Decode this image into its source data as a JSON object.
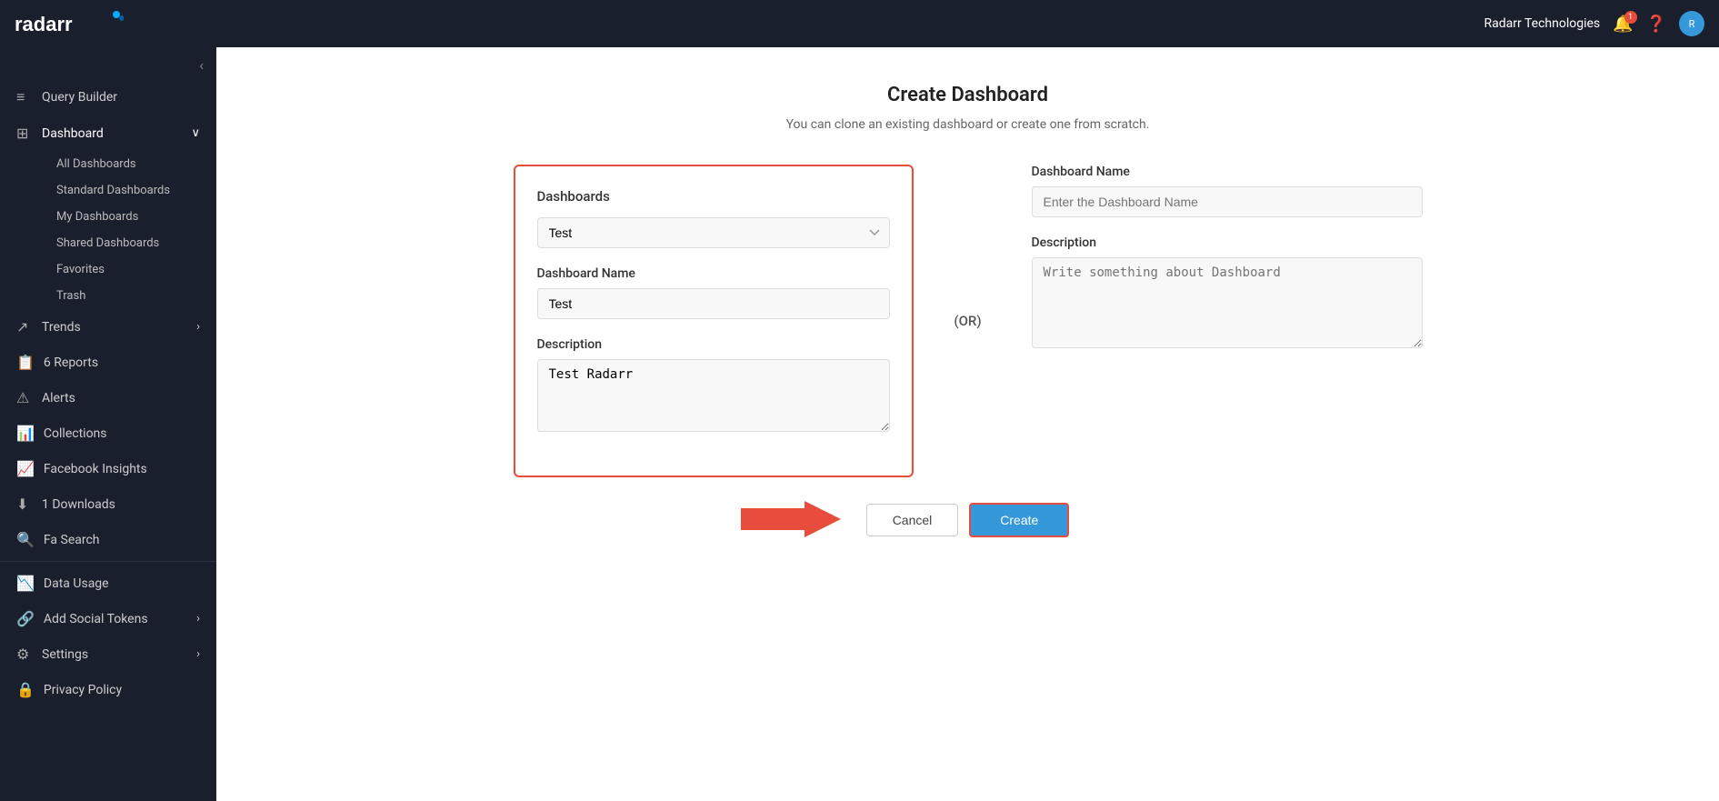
{
  "navbar": {
    "logo": "radarr",
    "company": "Radarr Technologies",
    "notification_count": "1",
    "avatar_text": "R"
  },
  "sidebar": {
    "collapse_icon": "‹",
    "items": [
      {
        "id": "query-builder",
        "label": "Query Builder",
        "icon": "≡",
        "has_chevron": false
      },
      {
        "id": "dashboard",
        "label": "Dashboard",
        "icon": "⊞",
        "has_chevron": true,
        "expanded": true
      },
      {
        "id": "all-dashboards",
        "label": "All Dashboards",
        "sub": true
      },
      {
        "id": "standard-dashboards",
        "label": "Standard Dashboards",
        "sub": true
      },
      {
        "id": "my-dashboards",
        "label": "My Dashboards",
        "sub": true
      },
      {
        "id": "shared-dashboards",
        "label": "Shared Dashboards",
        "sub": true
      },
      {
        "id": "favorites",
        "label": "Favorites",
        "sub": true
      },
      {
        "id": "trash",
        "label": "Trash",
        "sub": true
      },
      {
        "id": "trends",
        "label": "Trends",
        "icon": "↗",
        "has_chevron": true
      },
      {
        "id": "reports",
        "label": "6 Reports",
        "icon": "📋",
        "has_chevron": false
      },
      {
        "id": "alerts",
        "label": "Alerts",
        "icon": "⚠",
        "has_chevron": false
      },
      {
        "id": "collections",
        "label": "Collections",
        "icon": "📊",
        "has_chevron": false
      },
      {
        "id": "facebook-insights",
        "label": "Facebook Insights",
        "icon": "📈",
        "has_chevron": false
      },
      {
        "id": "downloads",
        "label": "1 Downloads",
        "icon": "⬇",
        "has_chevron": false
      },
      {
        "id": "search",
        "label": "Fa Search",
        "icon": "🔍",
        "has_chevron": false
      },
      {
        "id": "data-usage",
        "label": "Data Usage",
        "icon": "📉",
        "has_chevron": false
      },
      {
        "id": "add-social-tokens",
        "label": "Add Social Tokens",
        "icon": "🔗",
        "has_chevron": true
      },
      {
        "id": "settings",
        "label": "Settings",
        "icon": "⚙",
        "has_chevron": true
      },
      {
        "id": "privacy-policy",
        "label": "Privacy Policy",
        "icon": "🔒",
        "has_chevron": false
      }
    ]
  },
  "page": {
    "title": "Create Dashboard",
    "subtitle": "You can clone an existing dashboard or create one from scratch.",
    "or_label": "(OR)"
  },
  "clone_panel": {
    "section_title": "Dashboards",
    "select_value": "Test",
    "dashboard_name_label": "Dashboard Name",
    "dashboard_name_value": "Test",
    "description_label": "Description",
    "description_value": "Test Radarr"
  },
  "scratch_panel": {
    "dashboard_name_label": "Dashboard Name",
    "dashboard_name_placeholder": "Enter the Dashboard Name",
    "description_label": "Description",
    "description_placeholder": "Write something about Dashboard"
  },
  "buttons": {
    "cancel_label": "Cancel",
    "create_label": "Create"
  }
}
